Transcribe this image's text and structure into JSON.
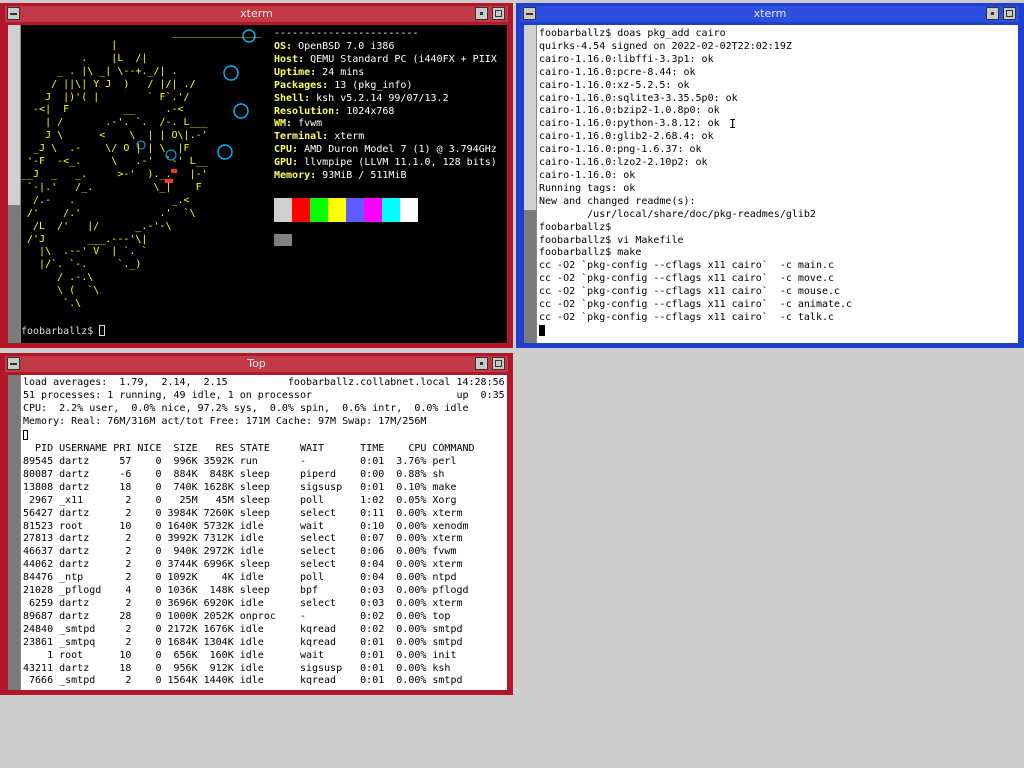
{
  "windows": {
    "xterm_left": {
      "title": "xterm",
      "logo_lines": [
        "                         _______________",
        "               |",
        "          .    |L  /|",
        "      _ . |\\ _| \\--+._/| .",
        "     / ||\\| Y J  )   / |/| ./",
        "    J  |)'( |        ` F`.'/",
        "  -<|  F         __     .-<",
        "    | /       .-'. `.  /-. L___",
        "    J \\      <    \\  | | O\\|.-'",
        "  _J \\  .-    \\/ O | | \\  |F",
        " '-F  -<_.     \\   .-'  `-' L__",
        "__J  _   _.     >-'  )._.   |-'",
        " `-|.'   /_.          \\_|    F",
        "  /.-   .                _.<",
        " /'    /.'             .'  `\\",
        "  /L  /'   |/      _.-'-\\",
        " /'J       ___.---'\\|",
        "   |\\  .--' V  | `. `",
        "   |/`. `-.     `._)",
        "      / .-.\\",
        "      \\ (  `\\",
        "       `.\\"
      ],
      "info": [
        {
          "key": "OS:",
          "value": "OpenBSD 7.0 i386"
        },
        {
          "key": "Host:",
          "value": "QEMU Standard PC (i440FX + PIIX"
        },
        {
          "key": "Uptime:",
          "value": "24 mins"
        },
        {
          "key": "Packages:",
          "value": "13 (pkg_info)"
        },
        {
          "key": "Shell:",
          "value": "ksh v5.2.14 99/07/13.2"
        },
        {
          "key": "Resolution:",
          "value": "1024x768"
        },
        {
          "key": "WM:",
          "value": "fvwm"
        },
        {
          "key": "Terminal:",
          "value": "xterm"
        },
        {
          "key": "CPU:",
          "value": "AMD Duron Model 7 (1) @ 3.794GHz"
        },
        {
          "key": "GPU:",
          "value": "llvmpipe (LLVM 11.1.0, 128 bits)"
        },
        {
          "key": "Memory:",
          "value": "93MiB / 511MiB"
        }
      ],
      "separator": "------------------------",
      "palette": [
        "#d0d0d0",
        "#ff0000",
        "#00ff00",
        "#ffff00",
        "#5c5cff",
        "#ff00ff",
        "#00ffff",
        "#ffffff",
        "#808080"
      ],
      "prompt": "foobarballz$ "
    },
    "xterm_right": {
      "title": "xterm",
      "lines": [
        "foobarballz$ doas pkg_add cairo",
        "quirks-4.54 signed on 2022-02-02T22:02:19Z",
        "cairo-1.16.0:libffi-3.3p1: ok",
        "cairo-1.16.0:pcre-8.44: ok",
        "cairo-1.16.0:xz-5.2.5: ok",
        "cairo-1.16.0:sqlite3-3.35.5p0: ok",
        "cairo-1.16.0:bzip2-1.0.8p0: ok",
        "cairo-1.16.0:python-3.8.12: ok",
        "cairo-1.16.0:glib2-2.68.4: ok",
        "cairo-1.16.0:png-1.6.37: ok",
        "cairo-1.16.0:lzo2-2.10p2: ok",
        "cairo-1.16.0: ok",
        "Running tags: ok",
        "New and changed readme(s):",
        "        /usr/local/share/doc/pkg-readmes/glib2",
        "foobarballz$",
        "foobarballz$ vi Makefile",
        "foobarballz$ make",
        "cc -O2 `pkg-config --cflags x11 cairo`  -c main.c",
        "cc -O2 `pkg-config --cflags x11 cairo`  -c move.c",
        "cc -O2 `pkg-config --cflags x11 cairo`  -c mouse.c",
        "cc -O2 `pkg-config --cflags x11 cairo`  -c animate.c",
        "cc -O2 `pkg-config --cflags x11 cairo`  -c talk.c"
      ],
      "mouse_cursor": "I"
    },
    "top": {
      "title": "Top",
      "header_lines": [
        "load averages:  1.79,  2.14,  2.15          foobarballz.collabnet.local 14:28:56",
        "51 processes: 1 running, 49 idle, 1 on processor                        up  0:35",
        "CPU:  2.2% user,  0.0% nice, 97.2% sys,  0.0% spin,  0.6% intr,  0.0% idle",
        "Memory: Real: 76M/316M act/tot Free: 171M Cache: 97M Swap: 17M/256M"
      ],
      "columns": "  PID USERNAME PRI NICE  SIZE   RES STATE     WAIT      TIME    CPU COMMAND",
      "rows": [
        "89545 dartz     57    0  996K 3592K run       -         0:01  3.76% perl",
        "80087 dartz     -6    0  884K  848K sleep     piperd    0:00  0.88% sh",
        "13808 dartz     18    0  740K 1628K sleep     sigsusp   0:01  0.10% make",
        " 2967 _x11       2    0   25M   45M sleep     poll      1:02  0.05% Xorg",
        "56427 dartz      2    0 3984K 7260K sleep     select    0:11  0.00% xterm",
        "81523 root      10    0 1640K 5732K idle      wait      0:10  0.00% xenodm",
        "27813 dartz      2    0 3992K 7312K idle      select    0:07  0.00% xterm",
        "46637 dartz      2    0  940K 2972K idle      select    0:06  0.00% fvwm",
        "44062 dartz      2    0 3744K 6996K sleep     select    0:04  0.00% xterm",
        "84476 _ntp       2    0 1092K    4K idle      poll      0:04  0.00% ntpd",
        "21028 _pflogd    4    0 1036K  148K sleep     bpf       0:03  0.00% pflogd",
        " 6259 dartz      2    0 3696K 6920K idle      select    0:03  0.00% xterm",
        "89687 dartz     28    0 1000K 2052K onproc    -         0:02  0.00% top",
        "24840 _smtpd     2    0 2172K 1676K idle      kqread    0:02  0.00% smtpd",
        "23861 _smtpq     2    0 1684K 1304K idle      kqread    0:01  0.00% smtpd",
        "    1 root      10    0  656K  160K idle      wait      0:01  0.00% init",
        "43211 dartz     18    0  956K  912K idle      sigsusp   0:01  0.00% ksh",
        " 7666 _smtpd     2    0 1564K 1440K idle      kqread    0:01  0.00% smtpd"
      ]
    }
  },
  "colors": {
    "focused_frame": "#1f3fcf",
    "unfocused_frame": "#b3162a",
    "logo": "#ffff00",
    "logo_accent": "#00b7ff",
    "logo_eyes": "#ff3030",
    "info_key": "#ffff66",
    "info_value": "#ffffff"
  }
}
